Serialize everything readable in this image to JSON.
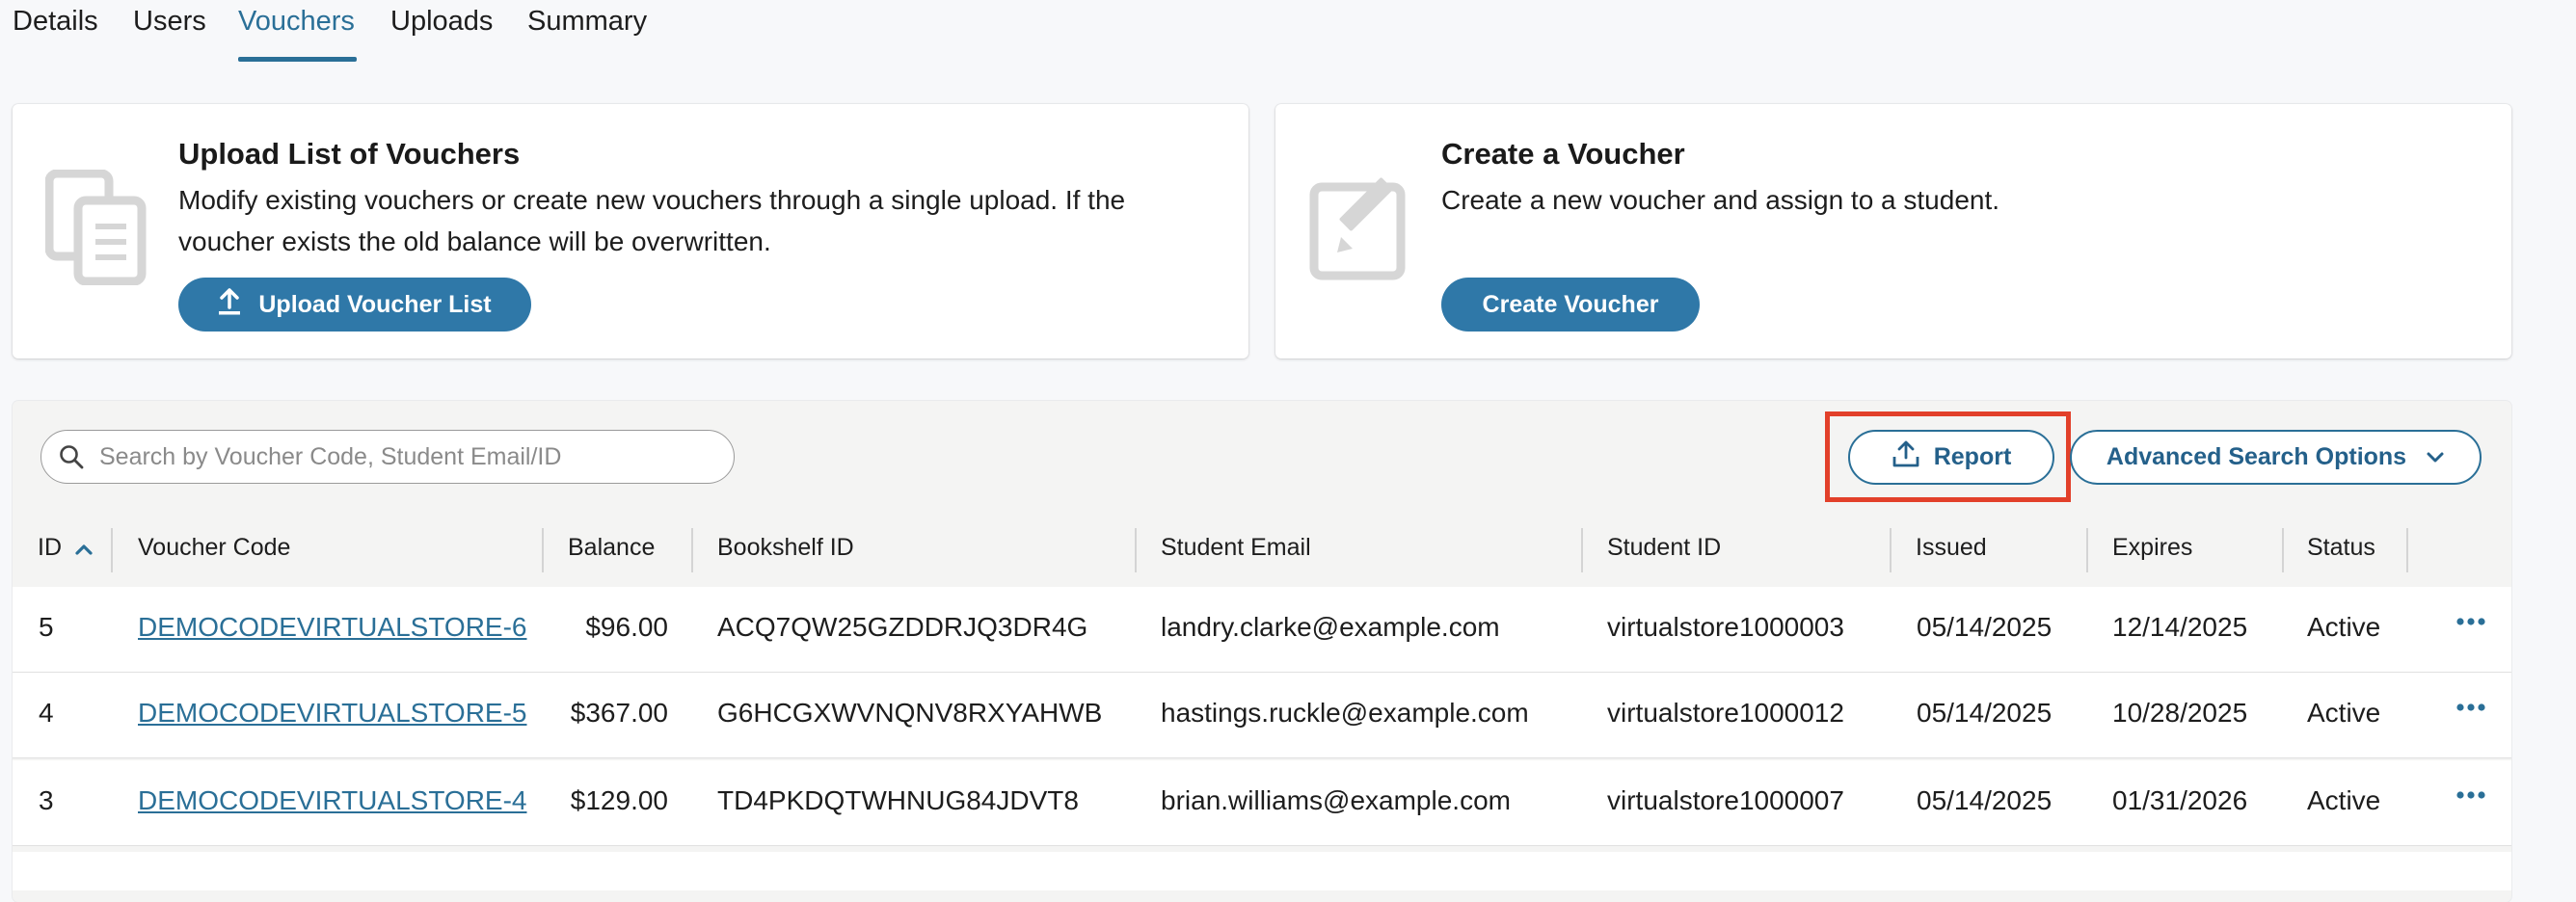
{
  "tabs": [
    {
      "label": "Details"
    },
    {
      "label": "Users"
    },
    {
      "label": "Vouchers"
    },
    {
      "label": "Uploads"
    },
    {
      "label": "Summary"
    }
  ],
  "active_tab": "Vouchers",
  "upload_card": {
    "title": "Upload List of Vouchers",
    "description": "Modify existing vouchers or create new vouchers through a single upload. If the voucher exists the old balance will be overwritten.",
    "button": "Upload Voucher List",
    "icon": "copy-document-icon"
  },
  "create_card": {
    "title": "Create a Voucher",
    "description": "Create a new voucher and assign to a student.",
    "button": "Create Voucher",
    "icon": "edit-icon"
  },
  "search": {
    "placeholder": "Search by Voucher Code, Student Email/ID",
    "value": ""
  },
  "toolbar": {
    "report_label": "Report",
    "advanced_label": "Advanced Search Options"
  },
  "table": {
    "columns": [
      "ID",
      "Voucher Code",
      "Balance",
      "Bookshelf ID",
      "Student Email",
      "Student ID",
      "Issued",
      "Expires",
      "Status"
    ],
    "sort": {
      "column": "ID",
      "direction": "ascending"
    },
    "rows": [
      {
        "id": "5",
        "code": "DEMOCODEVIRTUALSTORE-6",
        "balance": "$96.00",
        "bookshelf": "ACQ7QW25GZDDRJQ3DR4G",
        "email": "landry.clarke@example.com",
        "student_id": "virtualstore1000003",
        "issued": "05/14/2025",
        "expires": "12/14/2025",
        "status": "Active"
      },
      {
        "id": "4",
        "code": "DEMOCODEVIRTUALSTORE-5",
        "balance": "$367.00",
        "bookshelf": "G6HCGXWVNQNV8RXYAHWB",
        "email": "hastings.ruckle@example.com",
        "student_id": "virtualstore1000012",
        "issued": "05/14/2025",
        "expires": "10/28/2025",
        "status": "Active"
      },
      {
        "id": "3",
        "code": "DEMOCODEVIRTUALSTORE-4",
        "balance": "$129.00",
        "bookshelf": "TD4PKDQTWHNUG84JDVT8",
        "email": "brian.williams@example.com",
        "student_id": "virtualstore1000007",
        "issued": "05/14/2025",
        "expires": "01/31/2026",
        "status": "Active"
      }
    ]
  },
  "colors": {
    "accent": "#2a6f97",
    "primary_button": "#2f78a8",
    "highlight": "#e2402a"
  }
}
